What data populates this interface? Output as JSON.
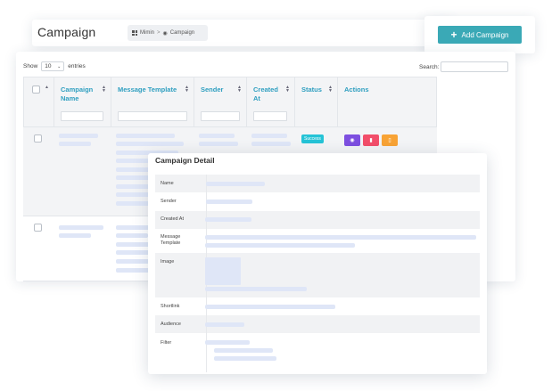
{
  "header": {
    "title": "Campaign",
    "breadcrumb": {
      "home": "Mimin",
      "separator": ">",
      "current": "Campaign"
    }
  },
  "add_button": {
    "label": "Add Campaign",
    "icon": "plus-icon"
  },
  "table": {
    "show_label": "Show",
    "entries_value": "10",
    "entries_label": "entries",
    "search_label": "Search:",
    "columns": [
      {
        "label": "Campaign Name"
      },
      {
        "label": "Message Template"
      },
      {
        "label": "Sender"
      },
      {
        "label": "Created At"
      },
      {
        "label": "Status"
      },
      {
        "label": "Actions"
      }
    ],
    "rows": [
      {
        "status": "Success"
      }
    ],
    "colors": {
      "view": "#7d4fe0",
      "delete": "#f24e6a",
      "file": "#f8a335",
      "status": "#25c3d6",
      "header_text": "#2f9fc0"
    }
  },
  "detail": {
    "title": "Campaign Detail",
    "labels": {
      "name": "Name",
      "sender": "Sender",
      "created_at": "Created At",
      "message_template": "Message Template",
      "image": "Image",
      "shortlink": "Shortlink",
      "audience": "Audience",
      "filter": "Filter"
    }
  },
  "accent_color": "#3aa9b6"
}
